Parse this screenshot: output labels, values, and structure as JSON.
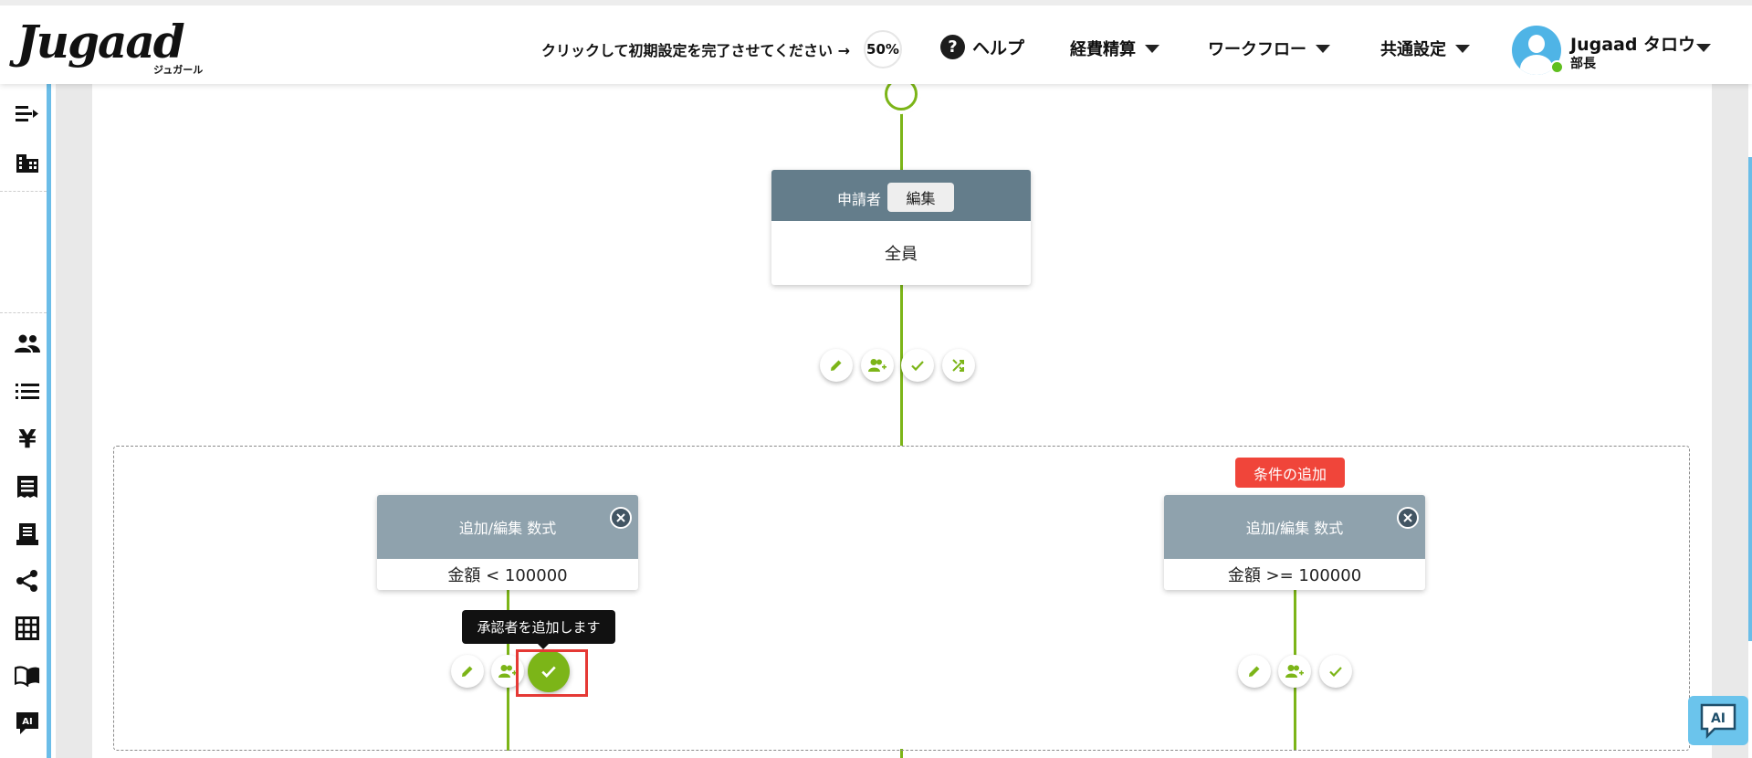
{
  "header": {
    "logo_text": "Jugaad",
    "logo_subtext": "ジュガール",
    "setup_prompt": "クリックして初期設定を完了させてください →",
    "setup_progress": "50%",
    "help_label": "ヘルプ",
    "menus": [
      {
        "label": "経費精算"
      },
      {
        "label": "ワークフロー"
      },
      {
        "label": "共通設定"
      }
    ],
    "user": {
      "name": "Jugaad タロウ",
      "role": "部長",
      "status_color": "#5fbf1f"
    }
  },
  "sidebar": {
    "icons": [
      "collapse-menu-icon",
      "company-building-icon",
      "users-icon",
      "list-icon",
      "yen-icon",
      "receipt-icon",
      "document-icon",
      "share-icon",
      "grid-icon",
      "book-icon",
      "ai-chat-icon"
    ],
    "ai_label": "AI"
  },
  "workflow": {
    "applicant_node": {
      "title": "申請者",
      "edit_label": "編集",
      "value": "全員"
    },
    "add_condition_label": "条件の追加",
    "conditions": [
      {
        "title": "追加/編集 数式",
        "formula": "金額 < 100000"
      },
      {
        "title": "追加/編集 数式",
        "formula": "金額 >= 100000"
      }
    ],
    "tooltip": "承認者を追加します"
  },
  "chat_widget": {
    "label": "AI"
  },
  "colors": {
    "accent_green": "#7cb518",
    "node_header": "#647d8b",
    "condition_header": "#8fa2ad",
    "add_condition_red": "#f0453a",
    "sidebar_accent": "#6bbde8"
  }
}
